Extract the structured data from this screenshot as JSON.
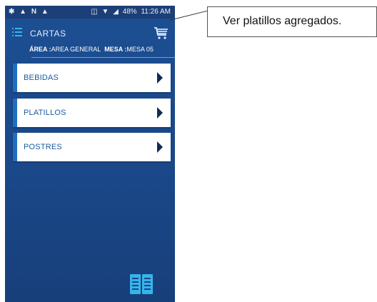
{
  "status_bar": {
    "left_icons": "✱ ▲ N ▲",
    "battery": "48%",
    "time": "11:26 AM"
  },
  "app_bar": {
    "title": "CARTAS",
    "menu_icon": "menu-icon",
    "cart_icon": "cart-icon"
  },
  "info": {
    "area_label": "ÁREA :",
    "area_value": "AREA GENERAL",
    "mesa_label": "MESA :",
    "mesa_value": "MESA 05"
  },
  "menu_items": [
    {
      "label": "BEBIDAS"
    },
    {
      "label": "PLATILLOS"
    },
    {
      "label": "POSTRES"
    }
  ],
  "callout": {
    "text": "Ver platillos agregados."
  },
  "colors": {
    "background_top": "#1c4f93",
    "accent_cyan": "#34b6e6",
    "item_accent": "#1f6fc1",
    "item_text": "#1c5aa0"
  }
}
